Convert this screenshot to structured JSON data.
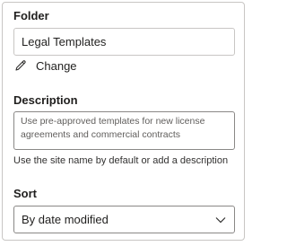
{
  "folder": {
    "label": "Folder",
    "value": "Legal Templates",
    "change_label": "Change",
    "change_icon": "pencil-icon"
  },
  "description": {
    "label": "Description",
    "placeholder": "Use pre-approved templates for new license agreements and commercial contracts",
    "helper_text": "Use the site name by default or add a description"
  },
  "sort": {
    "label": "Sort",
    "selected_option": "By date modified",
    "dropdown_icon": "chevron-down-icon"
  }
}
